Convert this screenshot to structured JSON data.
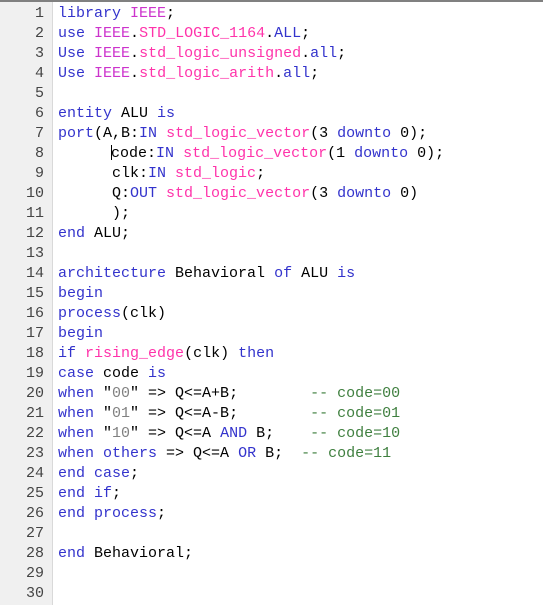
{
  "editor": {
    "name": "vhdl-code-editor",
    "gutter_background": "#f0f0f0",
    "background": "#ffffff",
    "first_line": 1,
    "last_line": 30,
    "total_lines": 30,
    "caret": {
      "line": 8,
      "column": 8
    },
    "colors": {
      "keyword": "#3333cc",
      "library": "#cc33cc",
      "type": "#ff33aa",
      "string": "#808080",
      "comment": "#3f7f3f",
      "plain": "#000000",
      "line_number": "#444444"
    }
  },
  "lines": [
    {
      "n": "1",
      "tokens": [
        {
          "t": "kw",
          "v": "library"
        },
        {
          "t": "pl",
          "v": " "
        },
        {
          "t": "lib",
          "v": "IEEE"
        },
        {
          "t": "pl",
          "v": ";"
        }
      ]
    },
    {
      "n": "2",
      "tokens": [
        {
          "t": "kw",
          "v": "use"
        },
        {
          "t": "pl",
          "v": " "
        },
        {
          "t": "lib",
          "v": "IEEE"
        },
        {
          "t": "pl",
          "v": "."
        },
        {
          "t": "type",
          "v": "STD_LOGIC_1164"
        },
        {
          "t": "pl",
          "v": "."
        },
        {
          "t": "kw",
          "v": "ALL"
        },
        {
          "t": "pl",
          "v": ";"
        }
      ]
    },
    {
      "n": "3",
      "tokens": [
        {
          "t": "kw",
          "v": "Use"
        },
        {
          "t": "pl",
          "v": " "
        },
        {
          "t": "lib",
          "v": "IEEE"
        },
        {
          "t": "pl",
          "v": "."
        },
        {
          "t": "type",
          "v": "std_logic_unsigned"
        },
        {
          "t": "pl",
          "v": "."
        },
        {
          "t": "kw",
          "v": "all"
        },
        {
          "t": "pl",
          "v": ";"
        }
      ]
    },
    {
      "n": "4",
      "tokens": [
        {
          "t": "kw",
          "v": "Use"
        },
        {
          "t": "pl",
          "v": " "
        },
        {
          "t": "lib",
          "v": "IEEE"
        },
        {
          "t": "pl",
          "v": "."
        },
        {
          "t": "type",
          "v": "std_logic_arith"
        },
        {
          "t": "pl",
          "v": "."
        },
        {
          "t": "kw",
          "v": "all"
        },
        {
          "t": "pl",
          "v": ";"
        }
      ]
    },
    {
      "n": "5",
      "tokens": []
    },
    {
      "n": "6",
      "tokens": [
        {
          "t": "kw",
          "v": "entity"
        },
        {
          "t": "pl",
          "v": " ALU "
        },
        {
          "t": "kw",
          "v": "is"
        }
      ]
    },
    {
      "n": "7",
      "tokens": [
        {
          "t": "kw",
          "v": "port"
        },
        {
          "t": "pl",
          "v": "(A,B:"
        },
        {
          "t": "kw",
          "v": "IN"
        },
        {
          "t": "pl",
          "v": " "
        },
        {
          "t": "type",
          "v": "std_logic_vector"
        },
        {
          "t": "pl",
          "v": "(3 "
        },
        {
          "t": "kw",
          "v": "downto"
        },
        {
          "t": "pl",
          "v": " 0);"
        }
      ]
    },
    {
      "n": "8",
      "tokens": [
        {
          "t": "pl",
          "v": "      "
        },
        {
          "t": "caret",
          "v": ""
        },
        {
          "t": "pl",
          "v": "code:"
        },
        {
          "t": "kw",
          "v": "IN"
        },
        {
          "t": "pl",
          "v": " "
        },
        {
          "t": "type",
          "v": "std_logic_vector"
        },
        {
          "t": "pl",
          "v": "(1 "
        },
        {
          "t": "kw",
          "v": "downto"
        },
        {
          "t": "pl",
          "v": " 0);"
        }
      ]
    },
    {
      "n": "9",
      "tokens": [
        {
          "t": "pl",
          "v": "      clk:"
        },
        {
          "t": "kw",
          "v": "IN"
        },
        {
          "t": "pl",
          "v": " "
        },
        {
          "t": "type",
          "v": "std_logic"
        },
        {
          "t": "pl",
          "v": ";"
        }
      ]
    },
    {
      "n": "10",
      "tokens": [
        {
          "t": "pl",
          "v": "      Q:"
        },
        {
          "t": "kw",
          "v": "OUT"
        },
        {
          "t": "pl",
          "v": " "
        },
        {
          "t": "type",
          "v": "std_logic_vector"
        },
        {
          "t": "pl",
          "v": "(3 "
        },
        {
          "t": "kw",
          "v": "downto"
        },
        {
          "t": "pl",
          "v": " 0)"
        }
      ]
    },
    {
      "n": "11",
      "tokens": [
        {
          "t": "pl",
          "v": "      );"
        }
      ]
    },
    {
      "n": "12",
      "tokens": [
        {
          "t": "kw",
          "v": "end"
        },
        {
          "t": "pl",
          "v": " ALU;"
        }
      ]
    },
    {
      "n": "13",
      "tokens": []
    },
    {
      "n": "14",
      "tokens": [
        {
          "t": "kw",
          "v": "architecture"
        },
        {
          "t": "pl",
          "v": " Behavioral "
        },
        {
          "t": "kw",
          "v": "of"
        },
        {
          "t": "pl",
          "v": " ALU "
        },
        {
          "t": "kw",
          "v": "is"
        }
      ]
    },
    {
      "n": "15",
      "tokens": [
        {
          "t": "kw",
          "v": "begin"
        }
      ]
    },
    {
      "n": "16",
      "tokens": [
        {
          "t": "kw",
          "v": "process"
        },
        {
          "t": "pl",
          "v": "(clk)"
        }
      ]
    },
    {
      "n": "17",
      "tokens": [
        {
          "t": "kw",
          "v": "begin"
        }
      ]
    },
    {
      "n": "18",
      "tokens": [
        {
          "t": "kw",
          "v": "if"
        },
        {
          "t": "pl",
          "v": " "
        },
        {
          "t": "type",
          "v": "rising_edge"
        },
        {
          "t": "pl",
          "v": "(clk) "
        },
        {
          "t": "kw",
          "v": "then"
        }
      ]
    },
    {
      "n": "19",
      "tokens": [
        {
          "t": "kw",
          "v": "case"
        },
        {
          "t": "pl",
          "v": " code "
        },
        {
          "t": "kw",
          "v": "is"
        }
      ]
    },
    {
      "n": "20",
      "tokens": [
        {
          "t": "kw",
          "v": "when"
        },
        {
          "t": "pl",
          "v": " \""
        },
        {
          "t": "str",
          "v": "00"
        },
        {
          "t": "pl",
          "v": "\" => Q<=A+B;        "
        },
        {
          "t": "cmt",
          "v": "-- code=00"
        }
      ]
    },
    {
      "n": "21",
      "tokens": [
        {
          "t": "kw",
          "v": "when"
        },
        {
          "t": "pl",
          "v": " \""
        },
        {
          "t": "str",
          "v": "01"
        },
        {
          "t": "pl",
          "v": "\" => Q<=A-B;        "
        },
        {
          "t": "cmt",
          "v": "-- code=01"
        }
      ]
    },
    {
      "n": "22",
      "tokens": [
        {
          "t": "kw",
          "v": "when"
        },
        {
          "t": "pl",
          "v": " \""
        },
        {
          "t": "str",
          "v": "10"
        },
        {
          "t": "pl",
          "v": "\" => Q<=A "
        },
        {
          "t": "kw",
          "v": "AND"
        },
        {
          "t": "pl",
          "v": " B;    "
        },
        {
          "t": "cmt",
          "v": "-- code=10"
        }
      ]
    },
    {
      "n": "23",
      "tokens": [
        {
          "t": "kw",
          "v": "when"
        },
        {
          "t": "pl",
          "v": " "
        },
        {
          "t": "kw",
          "v": "others"
        },
        {
          "t": "pl",
          "v": " => Q<=A "
        },
        {
          "t": "kw",
          "v": "OR"
        },
        {
          "t": "pl",
          "v": " B;  "
        },
        {
          "t": "cmt",
          "v": "-- code=11"
        }
      ]
    },
    {
      "n": "24",
      "tokens": [
        {
          "t": "kw",
          "v": "end"
        },
        {
          "t": "pl",
          "v": " "
        },
        {
          "t": "kw",
          "v": "case"
        },
        {
          "t": "pl",
          "v": ";"
        }
      ]
    },
    {
      "n": "25",
      "tokens": [
        {
          "t": "kw",
          "v": "end"
        },
        {
          "t": "pl",
          "v": " "
        },
        {
          "t": "kw",
          "v": "if"
        },
        {
          "t": "pl",
          "v": ";"
        }
      ]
    },
    {
      "n": "26",
      "tokens": [
        {
          "t": "kw",
          "v": "end"
        },
        {
          "t": "pl",
          "v": " "
        },
        {
          "t": "kw",
          "v": "process"
        },
        {
          "t": "pl",
          "v": ";"
        }
      ]
    },
    {
      "n": "27",
      "tokens": []
    },
    {
      "n": "28",
      "tokens": [
        {
          "t": "kw",
          "v": "end"
        },
        {
          "t": "pl",
          "v": " Behavioral;"
        }
      ]
    },
    {
      "n": "29",
      "tokens": []
    },
    {
      "n": "30",
      "tokens": []
    }
  ],
  "plain_text": "library IEEE;\nuse IEEE.STD_LOGIC_1164.ALL;\nUse IEEE.std_logic_unsigned.all;\nUse IEEE.std_logic_arith.all;\n\nentity ALU is\nport(A,B:IN std_logic_vector(3 downto 0);\n      code:IN std_logic_vector(1 downto 0);\n      clk:IN std_logic;\n      Q:OUT std_logic_vector(3 downto 0)\n      );\nend ALU;\n\narchitecture Behavioral of ALU is\nbegin\nprocess(clk)\nbegin\nif rising_edge(clk) then\ncase code is\nwhen \"00\" => Q<=A+B;        -- code=00\nwhen \"01\" => Q<=A-B;        -- code=01\nwhen \"10\" => Q<=A AND B;    -- code=10\nwhen others => Q<=A OR B;  -- code=11\nend case;\nend if;\nend process;\n\nend Behavioral;\n\n"
}
